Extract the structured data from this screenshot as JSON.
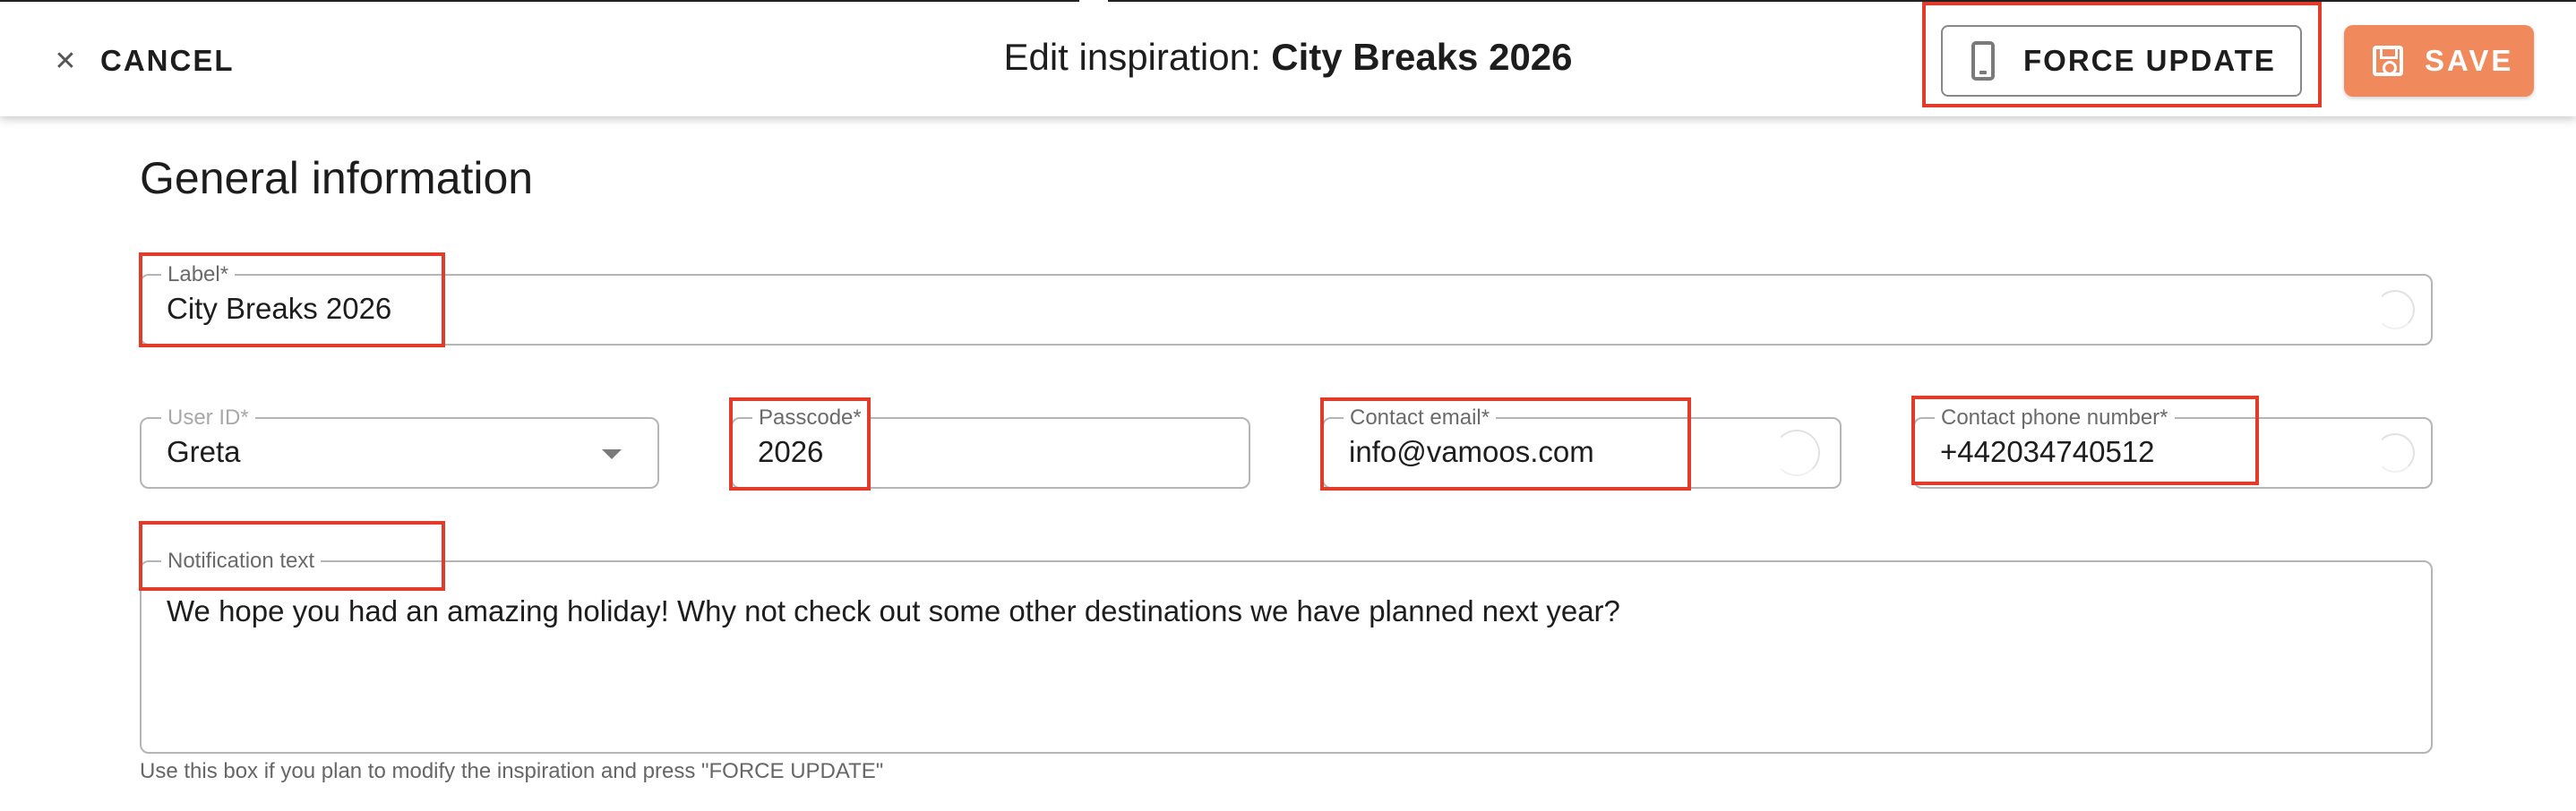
{
  "header": {
    "cancel_label": "CANCEL",
    "cancel_icon": "close-icon",
    "title_prefix": "Edit inspiration: ",
    "title_name": "City Breaks 2026",
    "force_update_label": "FORCE UPDATE",
    "force_update_icon": "smartphone-icon",
    "save_label": "SAVE",
    "save_icon": "floppy-disk-icon",
    "save_color": "#f08a5d"
  },
  "section": {
    "title": "General information"
  },
  "form": {
    "label": {
      "label": "Label*",
      "value": "City Breaks 2026"
    },
    "user_id": {
      "label": "User ID*",
      "value": "Greta"
    },
    "passcode": {
      "label": "Passcode*",
      "value": "2026"
    },
    "contact_email": {
      "label": "Contact email*",
      "value": "info@vamoos.com"
    },
    "contact_phone": {
      "label": "Contact phone number*",
      "value": "+442034740512"
    },
    "notification": {
      "label": "Notification text",
      "value": "We hope you had an amazing holiday! Why not check out some other destinations we have planned next year?",
      "helper": "Use this box if you plan to modify the inspiration and press \"FORCE UPDATE\""
    }
  },
  "annotation_color": "#e23b2a"
}
